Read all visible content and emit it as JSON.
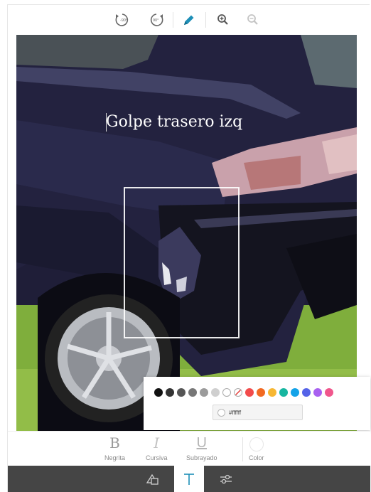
{
  "toolbar": {
    "rotate_left_label": "-90°",
    "rotate_right_label": "90°",
    "icons": [
      "rotate-left-icon",
      "rotate-right-icon",
      "pencil-icon",
      "zoom-in-icon",
      "zoom-out-icon"
    ]
  },
  "canvas": {
    "text_annotation": "Golpe trasero izq"
  },
  "color_popup": {
    "swatches": [
      "#111111",
      "#333333",
      "#555555",
      "#777777",
      "#9b9b9b",
      "#cfcfcf",
      "#ffffff",
      "none",
      "#f24b4b",
      "#f26a22",
      "#f7b733",
      "#16b6a0",
      "#14a3e8",
      "#5563e8",
      "#a860f0",
      "#f0568c"
    ],
    "hex_value": "#ffffff"
  },
  "format_bar": {
    "bold_glyph": "B",
    "bold_label": "Negrita",
    "italic_glyph": "I",
    "italic_label": "Cursiva",
    "underline_glyph": "U",
    "underline_label": "Subrayado",
    "color_label": "Color"
  },
  "tab_bar": {
    "tabs": [
      "shapes-icon",
      "text-icon",
      "adjust-icon"
    ],
    "active": "text-icon"
  },
  "colors": {
    "accent": "#1e8fb7",
    "tab_bar_bg": "#454545"
  }
}
